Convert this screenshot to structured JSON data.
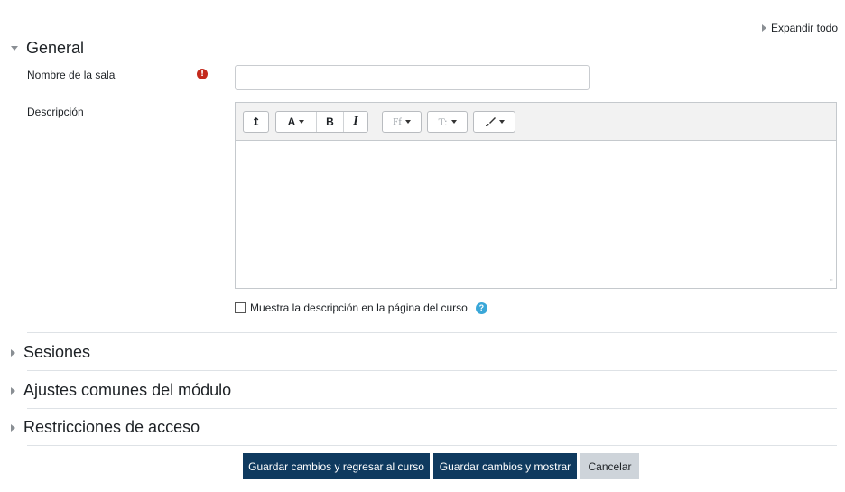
{
  "expand_all_label": "Expandir todo",
  "sections": {
    "general": "General",
    "sesiones": "Sesiones",
    "ajustes": "Ajustes comunes del módulo",
    "restricciones": "Restricciones de acceso"
  },
  "form": {
    "room_name_label": "Nombre de la sala",
    "room_name_value": "",
    "description_label": "Descripción",
    "show_description_label": "Muestra la descripción en la página del curso"
  },
  "toolbar": {
    "collapse": "↥",
    "font_color": "A",
    "bold": "B",
    "italic": "I",
    "font_family": "Ff",
    "font_size": "T:",
    "paint": "🖌"
  },
  "buttons": {
    "save_return": "Guardar cambios y regresar al curso",
    "save_display": "Guardar cambios y mostrar",
    "cancel": "Cancelar"
  },
  "colors": {
    "primary": "#0f3a5f",
    "required": "#c4291c",
    "help": "#3aa7d8"
  }
}
